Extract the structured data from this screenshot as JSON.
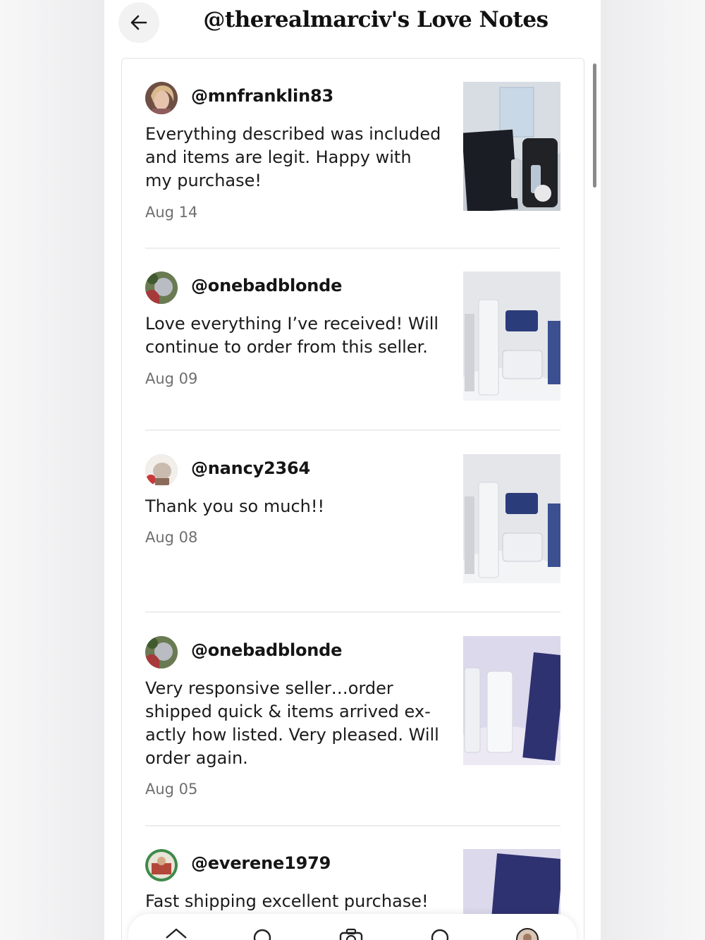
{
  "header": {
    "title": "@therealmarciv's Love Notes",
    "back_icon": "arrow-left-icon"
  },
  "notes": [
    {
      "username": "@mnfranklin83",
      "text": "Everything described was included and items are legit. Happy with my purchase!",
      "date": "Aug 14"
    },
    {
      "username": "@onebadblonde",
      "text": "Love everything I’ve received! Will continue to order from this seller.",
      "date": "Aug 09"
    },
    {
      "username": "@nancy2364",
      "text": "Thank you so much!!",
      "date": "Aug 08"
    },
    {
      "username": "@onebadblonde",
      "text": "Very responsive seller…order shipped quick & items arrived ex-actly how listed. Very pleased. Will order again.",
      "date": "Aug 05"
    },
    {
      "username": "@everene1979",
      "text": "Fast shipping excellent purchase!",
      "date": ""
    }
  ],
  "nav": {
    "items": [
      {
        "icon": "home-icon"
      },
      {
        "icon": "search-icon"
      },
      {
        "icon": "camera-icon"
      },
      {
        "icon": "chat-icon"
      },
      {
        "icon": "profile-avatar-icon"
      }
    ]
  },
  "colors": {
    "accent_bg": "#f2f2f3",
    "divider": "#ededed",
    "date_text": "#6f6f6f"
  }
}
